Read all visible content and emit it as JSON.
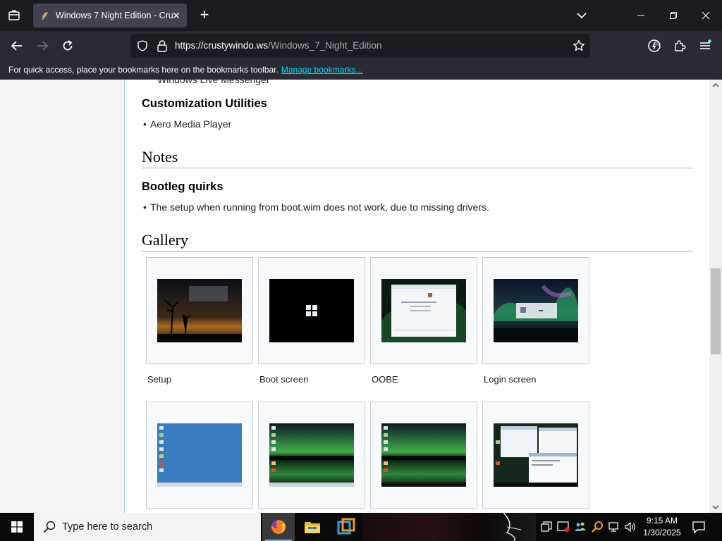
{
  "browser": {
    "tab_title": "Windows 7 Night Edition - Crus",
    "new_tab": "+",
    "close_glyph": "✕",
    "url_host": "https://crustywindo.ws",
    "url_path": "/Windows_7_Night_Edition",
    "bookmarks_message": "For quick access, place your bookmarks here on the bookmarks toolbar.",
    "manage_bookmarks": "Manage bookmarks..."
  },
  "content": {
    "cut_off_item": "Windows Live Messenger",
    "section_customization": "Customization Utilities",
    "customization_items": [
      "Aero Media Player"
    ],
    "heading_notes": "Notes",
    "section_bootleg": "Bootleg quirks",
    "bootleg_items": [
      "The setup when running from boot.wim does not work, due to missing drivers."
    ],
    "heading_gallery": "Gallery",
    "gallery": [
      {
        "caption": "Setup"
      },
      {
        "caption": "Boot screen"
      },
      {
        "caption": "OOBE"
      },
      {
        "caption": "Login screen"
      },
      {
        "caption": ""
      },
      {
        "caption": ""
      },
      {
        "caption": ""
      },
      {
        "caption": ""
      }
    ]
  },
  "taskbar": {
    "search_placeholder": "Type here to search",
    "time": "9:15 AM",
    "date": "1/30/2025"
  },
  "icons": {
    "tab_list": "list-all-tabs-icon",
    "back": "back-arrow-icon",
    "forward": "forward-arrow-icon",
    "reload": "reload-icon",
    "shield": "tracking-protection-shield-icon",
    "lock": "padlock-icon",
    "star": "bookmark-star-icon"
  },
  "colors": {
    "accent": "#00ddff",
    "chrome_dark": "#1c1b22",
    "chrome_mid": "#2b2a33",
    "tab_active": "#42414d",
    "wiki_border": "#a7d7f9"
  }
}
